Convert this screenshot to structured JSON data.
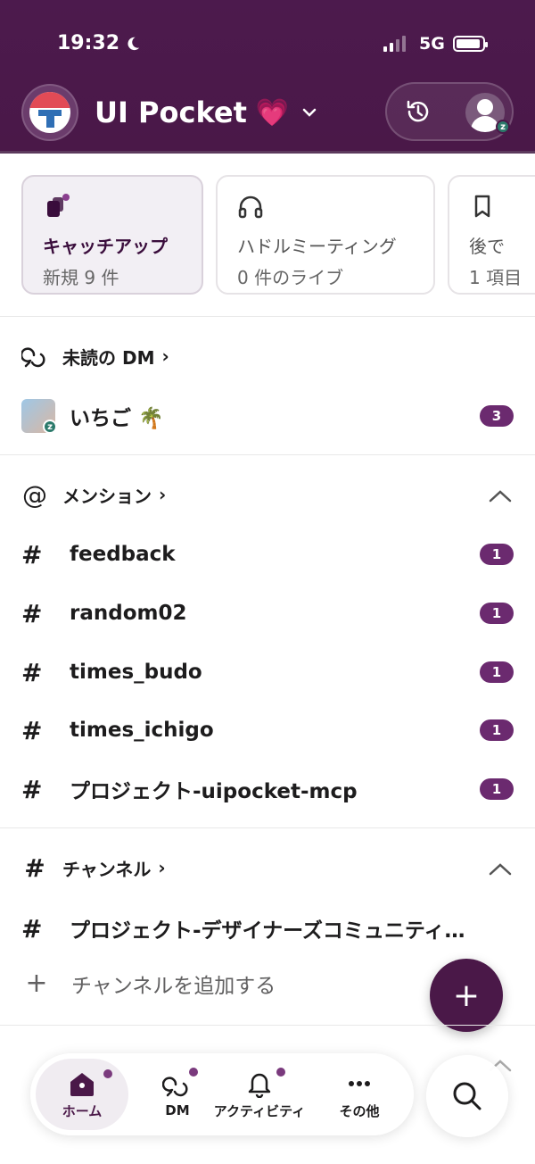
{
  "status_bar": {
    "time": "19:32",
    "network": "5G"
  },
  "workspace": {
    "name": "UI Pocket",
    "emoji": "💗"
  },
  "cards": [
    {
      "title": "キャッチアップ",
      "subtitle": "新規 9 件"
    },
    {
      "title": "ハドルミーティング",
      "subtitle": "0 件のライブ"
    },
    {
      "title": "後で",
      "subtitle": "1 項目"
    }
  ],
  "unread_dm": {
    "header": "未読の DM",
    "chevron": "›",
    "items": [
      {
        "name": "いちご 🌴",
        "count": "3"
      }
    ]
  },
  "mentions": {
    "header": "メンション",
    "chevron": "›",
    "items": [
      {
        "name": "feedback",
        "count": "1"
      },
      {
        "name": "random02",
        "count": "1"
      },
      {
        "name": "times_budo",
        "count": "1"
      },
      {
        "name": "times_ichigo",
        "count": "1"
      },
      {
        "name": "プロジェクト-uipocket-mcp",
        "count": "1"
      }
    ]
  },
  "channels": {
    "header": "チャンネル",
    "chevron": "›",
    "items": [
      {
        "name": "プロジェクト-デザイナーズコミュニティ…"
      }
    ],
    "add_label": "チャンネルを追加する"
  },
  "fab_label": "+",
  "tabs": [
    {
      "label": "ホーム",
      "icon": "home-icon"
    },
    {
      "label": "DM",
      "icon": "dm-icon"
    },
    {
      "label": "アクティビティ",
      "icon": "bell-icon"
    },
    {
      "label": "その他",
      "icon": "more-icon"
    }
  ],
  "colors": {
    "brand": "#4a1848",
    "badge": "#6b2a6f",
    "accent_heart": "#ff6ec7"
  }
}
